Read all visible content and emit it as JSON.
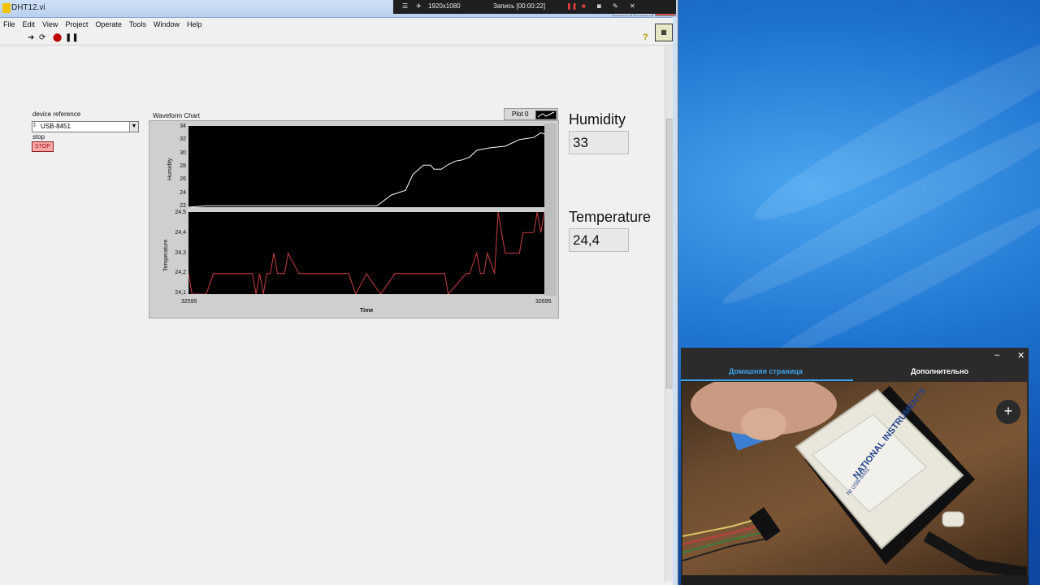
{
  "window": {
    "title": "DHT12.vi"
  },
  "menu": [
    "File",
    "Edit",
    "View",
    "Project",
    "Operate",
    "Tools",
    "Window",
    "Help"
  ],
  "recorder": {
    "resolution": "1920x1080",
    "status": "Запись [00:00:22]"
  },
  "controls": {
    "device_label": "device reference",
    "device_value": "USB-8451",
    "stop_label": "stop",
    "stop_button": "STOP"
  },
  "chart": {
    "title": "Waveform Chart",
    "legend": "Plot 0",
    "x_label": "Time",
    "x_min": "32595",
    "x_max": "32695",
    "humidity_axis": "Humidity",
    "temperature_axis": "Temperature",
    "humidity_ticks": [
      "34",
      "32",
      "30",
      "28",
      "26",
      "24",
      "22"
    ],
    "temperature_ticks": [
      "24,5",
      "24,4",
      "24,3",
      "24,2",
      "24,1"
    ]
  },
  "chart_data": {
    "type": "line",
    "title": "Waveform Chart",
    "xlabel": "Time",
    "xlim": [
      32595,
      32695
    ],
    "series": [
      {
        "name": "Humidity",
        "ylim": [
          22,
          34
        ],
        "x": [
          32595,
          32600,
          32606,
          32630,
          32648,
          32652,
          32656,
          32658,
          32661,
          32663,
          32664,
          32666,
          32668,
          32670,
          32672,
          32674,
          32676,
          32678,
          32680,
          32684,
          32688,
          32692,
          32694,
          32695
        ],
        "values": [
          22,
          22.2,
          22.2,
          22.2,
          22.2,
          23.8,
          24.5,
          26.8,
          28.2,
          28.2,
          27.6,
          27.6,
          28.3,
          28.8,
          29,
          29.4,
          30.4,
          30.6,
          30.8,
          31,
          32,
          32.3,
          33,
          32.8
        ],
        "color": "#ffffff"
      },
      {
        "name": "Temperature",
        "ylim": [
          24.1,
          24.5
        ],
        "x": [
          32595,
          32596,
          32600,
          32602,
          32613,
          32614,
          32615,
          32616,
          32617,
          32618,
          32619,
          32620,
          32621,
          32622,
          32623,
          32626,
          32640,
          32642,
          32645,
          32649,
          32653,
          32667,
          32668,
          32673,
          32674,
          32676,
          32677,
          32678,
          32679,
          32681,
          32682,
          32683,
          32684,
          32688,
          32689,
          32690,
          32692,
          32693,
          32694,
          32695
        ],
        "values": [
          24.2,
          24.1,
          24.1,
          24.2,
          24.2,
          24.1,
          24.2,
          24.1,
          24.2,
          24.2,
          24.3,
          24.2,
          24.2,
          24.2,
          24.3,
          24.2,
          24.2,
          24.1,
          24.2,
          24.1,
          24.2,
          24.2,
          24.1,
          24.2,
          24.2,
          24.3,
          24.2,
          24.2,
          24.3,
          24.2,
          24.5,
          24.4,
          24.3,
          24.3,
          24.4,
          24.4,
          24.4,
          24.5,
          24.4,
          24.5
        ],
        "color": "#c84040"
      }
    ]
  },
  "indicators": {
    "humidity_label": "Humidity",
    "humidity_value": "33",
    "temperature_label": "Temperature",
    "temperature_value": "24,4"
  },
  "camera": {
    "tab_home": "Домашняя страница",
    "tab_more": "Дополнительно",
    "device_brand": "NATIONAL INSTRUMENTS",
    "device_model": "NI USB-8451"
  },
  "colors": {
    "accent": "#3fa2e8",
    "stop_red": "#f7a7a7"
  }
}
